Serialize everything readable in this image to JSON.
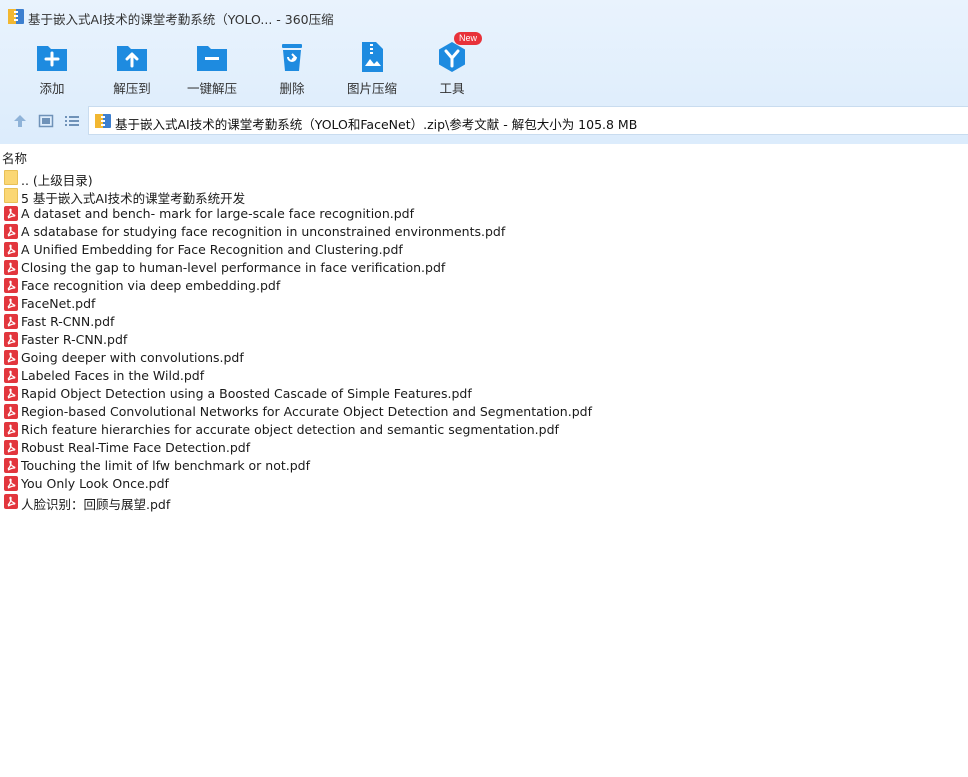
{
  "window": {
    "title": "基于嵌入式AI技术的课堂考勤系统（YOLO... - 360压缩"
  },
  "toolbar": {
    "add_label": "添加",
    "extract_to_label": "解压到",
    "one_click_extract_label": "一键解压",
    "delete_label": "删除",
    "image_compress_label": "图片压缩",
    "tools_label": "工具",
    "tools_badge": "New"
  },
  "address": {
    "path": "基于嵌入式AI技术的课堂考勤系统（YOLO和FaceNet）.zip\\参考文献 - 解包大小为 105.8 MB"
  },
  "columns": {
    "name": "名称"
  },
  "files": [
    {
      "name": ".. (上级目录)",
      "type": "folder"
    },
    {
      "name": "5 基于嵌入式AI技术的课堂考勤系统开发",
      "type": "folder"
    },
    {
      "name": "A dataset and bench- mark for large-scale face recognition.pdf",
      "type": "pdf"
    },
    {
      "name": "A sdatabase for studying face recognition in unconstrained environments.pdf",
      "type": "pdf"
    },
    {
      "name": "A Unified Embedding for Face Recognition and Clustering.pdf",
      "type": "pdf"
    },
    {
      "name": "Closing the gap to human-level performance in face verification.pdf",
      "type": "pdf"
    },
    {
      "name": "Face recognition via deep embedding.pdf",
      "type": "pdf"
    },
    {
      "name": "FaceNet.pdf",
      "type": "pdf"
    },
    {
      "name": "Fast R-CNN.pdf",
      "type": "pdf"
    },
    {
      "name": "Faster R-CNN.pdf",
      "type": "pdf"
    },
    {
      "name": "Going deeper with convolutions.pdf",
      "type": "pdf"
    },
    {
      "name": "Labeled Faces in the Wild.pdf",
      "type": "pdf"
    },
    {
      "name": "Rapid Object Detection using a Boosted Cascade of Simple Features.pdf",
      "type": "pdf"
    },
    {
      "name": "Region-based Convolutional Networks for Accurate Object Detection and Segmentation.pdf",
      "type": "pdf"
    },
    {
      "name": "Rich feature hierarchies for accurate object detection and semantic segmentation.pdf",
      "type": "pdf"
    },
    {
      "name": "Robust Real-Time Face Detection.pdf",
      "type": "pdf"
    },
    {
      "name": "Touching the limit of lfw benchmark or not.pdf",
      "type": "pdf"
    },
    {
      "name": "You Only Look Once.pdf",
      "type": "pdf"
    },
    {
      "name": "人脸识别：回顾与展望.pdf",
      "type": "pdf"
    }
  ],
  "colors": {
    "toolbar_icon": "#1e8be0",
    "header_bg": "#dcecfc",
    "folder": "#fbd774",
    "pdf": "#e2363d",
    "badge": "#e8323a"
  }
}
